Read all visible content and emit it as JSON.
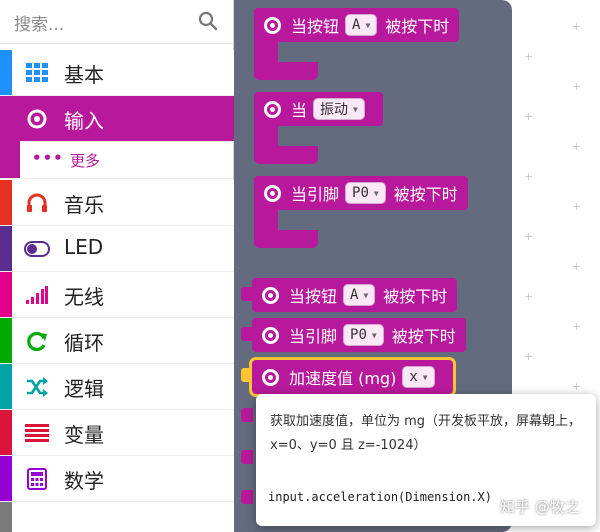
{
  "search": {
    "placeholder": "搜索..."
  },
  "categories": [
    {
      "label": "基本",
      "color": "#1e90ff",
      "icon": "grid-icon",
      "selected": false
    },
    {
      "label": "输入",
      "color": "#b8199c",
      "icon": "input-radio-icon",
      "selected": true
    },
    {
      "label": "音乐",
      "color": "#e63022",
      "icon": "headphones-icon",
      "selected": false
    },
    {
      "label": "LED",
      "color": "#5c2d91",
      "icon": "toggle-icon",
      "selected": false
    },
    {
      "label": "无线",
      "color": "#e3008c",
      "icon": "signal-bars-icon",
      "selected": false
    },
    {
      "label": "循环",
      "color": "#00aa00",
      "icon": "refresh-icon",
      "selected": false
    },
    {
      "label": "逻辑",
      "color": "#00a4a6",
      "icon": "shuffle-icon",
      "selected": false
    },
    {
      "label": "变量",
      "color": "#dc143c",
      "icon": "list-lines-icon",
      "selected": false
    },
    {
      "label": "数学",
      "color": "#9400d3",
      "icon": "calculator-icon",
      "selected": false
    }
  ],
  "subcategory": {
    "dots": "•••",
    "label": "更多"
  },
  "blocks": {
    "button_pressed": {
      "prefix": "当按钮",
      "value": "A",
      "suffix": "被按下时"
    },
    "gesture": {
      "prefix": "当",
      "value": "振动"
    },
    "pin_pressed": {
      "prefix": "当引脚",
      "value": "P0",
      "suffix": "被按下时"
    },
    "button_pressed_2": {
      "prefix": "当按钮",
      "value": "A",
      "suffix": "被按下时"
    },
    "pin_pressed_2": {
      "prefix": "当引脚",
      "value": "P0",
      "suffix": "被按下时"
    },
    "acceleration": {
      "prefix": "加速度值 (mg)",
      "value": "x"
    }
  },
  "tooltip": {
    "description": "获取加速度值，单位为 mg（开发板平放，屏幕朝上，x=0、y=0 且 z=-1024）",
    "code": "input.acceleration(Dimension.X)"
  },
  "watermark": "知乎 @牧之",
  "colors": {
    "input_block": "#b8199c",
    "flyout_bg": "#646b7f",
    "selection_outline": "#fcc531"
  }
}
